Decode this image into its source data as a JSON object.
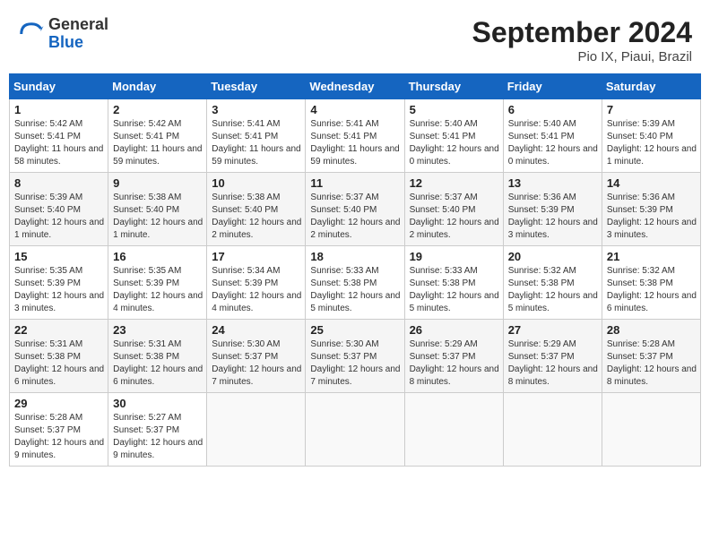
{
  "header": {
    "logo_general": "General",
    "logo_blue": "Blue",
    "month_year": "September 2024",
    "location": "Pio IX, Piaui, Brazil"
  },
  "weekdays": [
    "Sunday",
    "Monday",
    "Tuesday",
    "Wednesday",
    "Thursday",
    "Friday",
    "Saturday"
  ],
  "weeks": [
    [
      {
        "day": "1",
        "sunrise": "5:42 AM",
        "sunset": "5:41 PM",
        "daylight": "11 hours and 58 minutes."
      },
      {
        "day": "2",
        "sunrise": "5:42 AM",
        "sunset": "5:41 PM",
        "daylight": "11 hours and 59 minutes."
      },
      {
        "day": "3",
        "sunrise": "5:41 AM",
        "sunset": "5:41 PM",
        "daylight": "11 hours and 59 minutes."
      },
      {
        "day": "4",
        "sunrise": "5:41 AM",
        "sunset": "5:41 PM",
        "daylight": "11 hours and 59 minutes."
      },
      {
        "day": "5",
        "sunrise": "5:40 AM",
        "sunset": "5:41 PM",
        "daylight": "12 hours and 0 minutes."
      },
      {
        "day": "6",
        "sunrise": "5:40 AM",
        "sunset": "5:41 PM",
        "daylight": "12 hours and 0 minutes."
      },
      {
        "day": "7",
        "sunrise": "5:39 AM",
        "sunset": "5:40 PM",
        "daylight": "12 hours and 1 minute."
      }
    ],
    [
      {
        "day": "8",
        "sunrise": "5:39 AM",
        "sunset": "5:40 PM",
        "daylight": "12 hours and 1 minute."
      },
      {
        "day": "9",
        "sunrise": "5:38 AM",
        "sunset": "5:40 PM",
        "daylight": "12 hours and 1 minute."
      },
      {
        "day": "10",
        "sunrise": "5:38 AM",
        "sunset": "5:40 PM",
        "daylight": "12 hours and 2 minutes."
      },
      {
        "day": "11",
        "sunrise": "5:37 AM",
        "sunset": "5:40 PM",
        "daylight": "12 hours and 2 minutes."
      },
      {
        "day": "12",
        "sunrise": "5:37 AM",
        "sunset": "5:40 PM",
        "daylight": "12 hours and 2 minutes."
      },
      {
        "day": "13",
        "sunrise": "5:36 AM",
        "sunset": "5:39 PM",
        "daylight": "12 hours and 3 minutes."
      },
      {
        "day": "14",
        "sunrise": "5:36 AM",
        "sunset": "5:39 PM",
        "daylight": "12 hours and 3 minutes."
      }
    ],
    [
      {
        "day": "15",
        "sunrise": "5:35 AM",
        "sunset": "5:39 PM",
        "daylight": "12 hours and 3 minutes."
      },
      {
        "day": "16",
        "sunrise": "5:35 AM",
        "sunset": "5:39 PM",
        "daylight": "12 hours and 4 minutes."
      },
      {
        "day": "17",
        "sunrise": "5:34 AM",
        "sunset": "5:39 PM",
        "daylight": "12 hours and 4 minutes."
      },
      {
        "day": "18",
        "sunrise": "5:33 AM",
        "sunset": "5:38 PM",
        "daylight": "12 hours and 5 minutes."
      },
      {
        "day": "19",
        "sunrise": "5:33 AM",
        "sunset": "5:38 PM",
        "daylight": "12 hours and 5 minutes."
      },
      {
        "day": "20",
        "sunrise": "5:32 AM",
        "sunset": "5:38 PM",
        "daylight": "12 hours and 5 minutes."
      },
      {
        "day": "21",
        "sunrise": "5:32 AM",
        "sunset": "5:38 PM",
        "daylight": "12 hours and 6 minutes."
      }
    ],
    [
      {
        "day": "22",
        "sunrise": "5:31 AM",
        "sunset": "5:38 PM",
        "daylight": "12 hours and 6 minutes."
      },
      {
        "day": "23",
        "sunrise": "5:31 AM",
        "sunset": "5:38 PM",
        "daylight": "12 hours and 6 minutes."
      },
      {
        "day": "24",
        "sunrise": "5:30 AM",
        "sunset": "5:37 PM",
        "daylight": "12 hours and 7 minutes."
      },
      {
        "day": "25",
        "sunrise": "5:30 AM",
        "sunset": "5:37 PM",
        "daylight": "12 hours and 7 minutes."
      },
      {
        "day": "26",
        "sunrise": "5:29 AM",
        "sunset": "5:37 PM",
        "daylight": "12 hours and 8 minutes."
      },
      {
        "day": "27",
        "sunrise": "5:29 AM",
        "sunset": "5:37 PM",
        "daylight": "12 hours and 8 minutes."
      },
      {
        "day": "28",
        "sunrise": "5:28 AM",
        "sunset": "5:37 PM",
        "daylight": "12 hours and 8 minutes."
      }
    ],
    [
      {
        "day": "29",
        "sunrise": "5:28 AM",
        "sunset": "5:37 PM",
        "daylight": "12 hours and 9 minutes."
      },
      {
        "day": "30",
        "sunrise": "5:27 AM",
        "sunset": "5:37 PM",
        "daylight": "12 hours and 9 minutes."
      },
      null,
      null,
      null,
      null,
      null
    ]
  ]
}
